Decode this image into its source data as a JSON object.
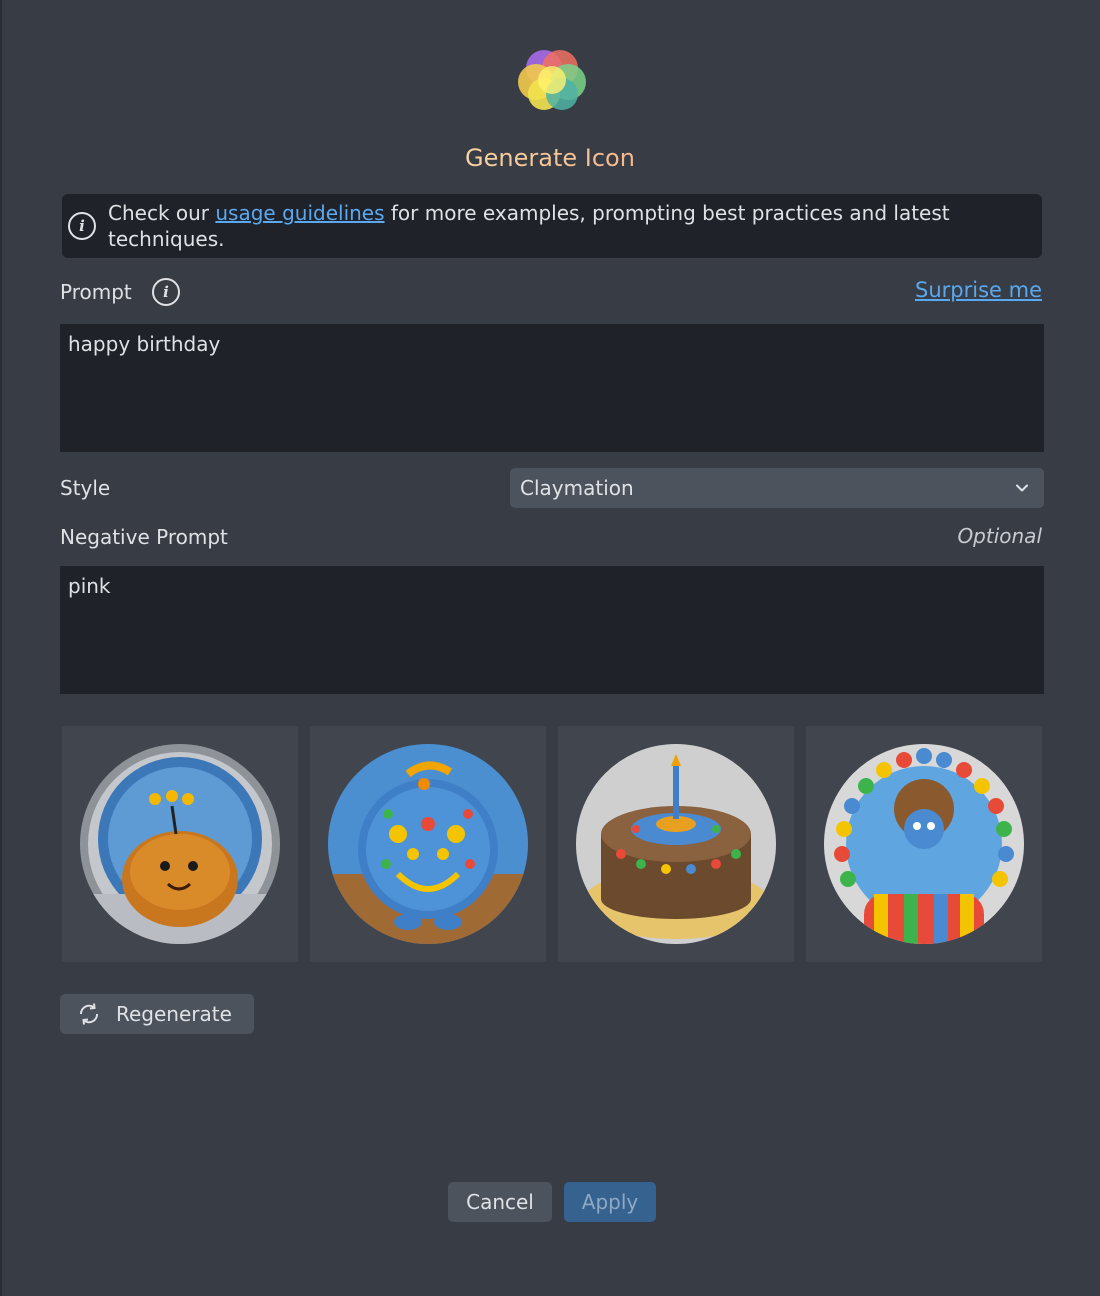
{
  "dialog": {
    "title": "Generate Icon"
  },
  "info": {
    "text_before": "Check our ",
    "link_text": "usage guidelines",
    "text_after": " for more examples, prompting best practices and latest techniques."
  },
  "prompt": {
    "label": "Prompt",
    "surprise_label": "Surprise me",
    "value": "happy birthday"
  },
  "style": {
    "label": "Style",
    "selected": "Claymation"
  },
  "negative_prompt": {
    "label": "Negative Prompt",
    "optional_label": "Optional",
    "value": "pink"
  },
  "results": [
    {
      "subject": "clay blob creature"
    },
    {
      "subject": "clay decorated ball"
    },
    {
      "subject": "clay birthday cake"
    },
    {
      "subject": "clay clown with balloons"
    }
  ],
  "actions": {
    "regenerate_label": "Regenerate",
    "cancel_label": "Cancel",
    "apply_label": "Apply"
  },
  "colors": {
    "background": "#373c45",
    "field": "#1f2229",
    "link": "#5aa9f0",
    "apply": "#35628f"
  }
}
